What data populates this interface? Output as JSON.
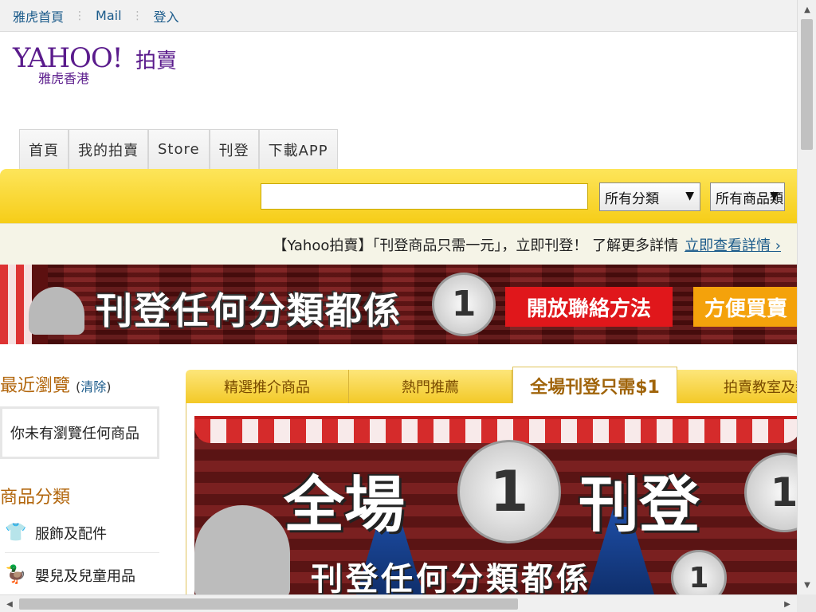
{
  "topbar": {
    "links": [
      "雅虎首頁",
      "Mail",
      "登入"
    ]
  },
  "logo": {
    "brand": "YAHOO!",
    "sub": "雅虎香港",
    "section": "拍賣"
  },
  "nav": {
    "tabs": [
      "首頁",
      "我的拍賣",
      "Store",
      "刊登",
      "下載APP"
    ]
  },
  "search": {
    "input_value": "",
    "category_select": "所有分類",
    "type_select": "所有商品類"
  },
  "notice": {
    "text": "【Yahoo拍賣】「刊登商品只需一元」，立即刊登！ 了解更多詳情",
    "link": "立即查看詳情 ›"
  },
  "banner": {
    "headline": "刊登任何分類都係",
    "coin": "1",
    "red_label": "開放聯絡方法",
    "orange_label": "方便買賣"
  },
  "sidebar": {
    "recent_title": "最近瀏覽",
    "recent_clear": "清除",
    "recent_box": "你未有瀏覽任何商品",
    "categories_title": "商品分類",
    "categories": [
      {
        "icon": "shirt-icon",
        "glyph": "👕",
        "label": "服飾及配件"
      },
      {
        "icon": "duck-icon",
        "glyph": "🦆",
        "label": "嬰兒及兒童用品"
      }
    ]
  },
  "promo": {
    "tabs": [
      "精選推介商品",
      "熱門推薦",
      "全場刊登只需$1",
      "拍賣教室及新手上路"
    ],
    "active_index": 2,
    "banner_left": "全場",
    "banner_right": "刊登",
    "banner_sub": "刊登任何分類都係",
    "coin": "1"
  }
}
